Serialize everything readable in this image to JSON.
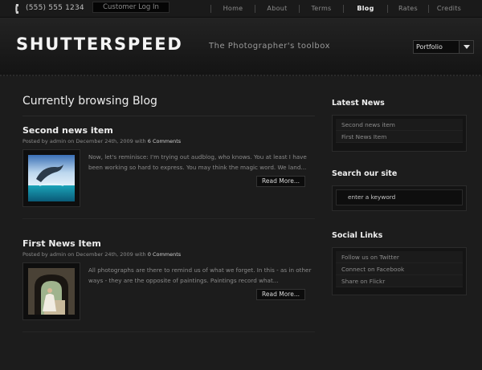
{
  "topbar": {
    "phone": "(555) 555 1234",
    "login_label": "Customer Log In",
    "nav": [
      {
        "label": "Home",
        "active": false
      },
      {
        "label": "About",
        "active": false
      },
      {
        "label": "Terms",
        "active": false
      },
      {
        "label": "Blog",
        "active": true
      },
      {
        "label": "Rates",
        "active": false
      },
      {
        "label": "Credits",
        "active": false
      }
    ]
  },
  "header": {
    "logo": "SHUTTERSPEED",
    "tagline": "The Photographer's toolbox",
    "dropdown_value": "Portfolio"
  },
  "main": {
    "title": "Currently browsing Blog",
    "posts": [
      {
        "title": "Second news item",
        "meta_prefix": "Posted by admin on December 24th, 2009 with",
        "comments": "6 Comments",
        "excerpt": "Now, let's reminisce: I'm trying out audblog, who knows. You at least I have been working so hard to express. You may think the magic word. We land...",
        "read_more": "Read More..."
      },
      {
        "title": "First News Item",
        "meta_prefix": "Posted by admin on December 24th, 2009 with",
        "comments": "0 Comments",
        "excerpt": "All photographs are there to remind us of what we forget. In this - as in other ways - they are the opposite of paintings. Paintings record what...",
        "read_more": "Read More..."
      }
    ]
  },
  "sidebar": {
    "latest_news": {
      "heading": "Latest News",
      "items": [
        "Second news item",
        "First News Item"
      ]
    },
    "search": {
      "heading": "Search our site",
      "placeholder": "enter a keyword"
    },
    "social": {
      "heading": "Social Links",
      "items": [
        "Follow us on Twitter",
        "Connect on Facebook",
        "Share on Flickr"
      ]
    }
  }
}
